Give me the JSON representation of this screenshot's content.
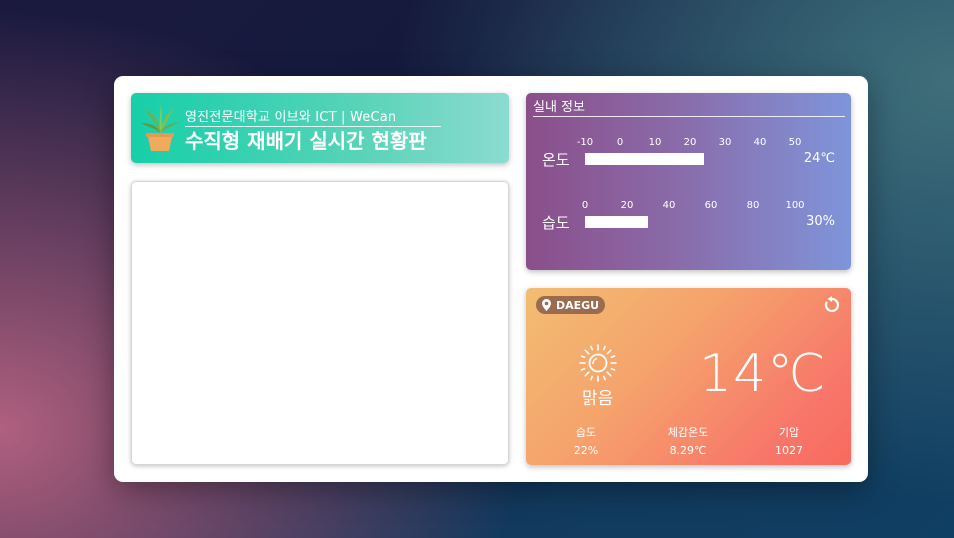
{
  "banner": {
    "subtitle": "영진전문대학교 이브와 ICT | WeCan",
    "title": "수직형 재배기 실시간 현황판"
  },
  "indoor": {
    "heading": "실내 정보",
    "temperature": {
      "label": "온도",
      "ticks": [
        "-10",
        "0",
        "10",
        "20",
        "30",
        "40",
        "50"
      ],
      "value": 24,
      "unit": "℃",
      "display": "24℃",
      "range": [
        -10,
        50
      ]
    },
    "humidity": {
      "label": "습도",
      "ticks": [
        "0",
        "20",
        "40",
        "60",
        "80",
        "100"
      ],
      "value": 30,
      "unit": "%",
      "display": "30%",
      "range": [
        0,
        100
      ]
    }
  },
  "weather": {
    "location": "DAEGU",
    "location_icon": "map-pin-icon",
    "refresh_icon": "refresh-icon",
    "condition_icon": "sun-icon",
    "condition": "맑음",
    "temperature": "14℃",
    "stats": [
      {
        "label": "습도",
        "value": "22%"
      },
      {
        "label": "체감온도",
        "value": "8.29℃"
      },
      {
        "label": "기압",
        "value": "1027"
      }
    ]
  },
  "colors": {
    "banner_start": "#16cfa9",
    "banner_end": "#8cdbd0",
    "indoor_start": "#8a4f8a",
    "indoor_end": "#7f95da",
    "weather_start": "#f2bd72",
    "weather_end": "#f86a5e",
    "location_pill": "#9a6b4e"
  }
}
